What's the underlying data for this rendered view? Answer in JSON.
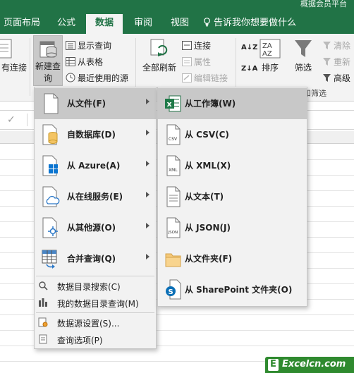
{
  "window": {
    "title_fragment": "概据会员平台"
  },
  "tabs": [
    {
      "label": "页面布局",
      "active": false
    },
    {
      "label": "公式",
      "active": false
    },
    {
      "label": "数据",
      "active": true
    },
    {
      "label": "审阅",
      "active": false
    },
    {
      "label": "视图",
      "active": false
    },
    {
      "label": "告诉我你想要做什么",
      "active": false
    }
  ],
  "ribbon": {
    "existing_connections": "有连接",
    "new_query": {
      "line1": "新建查",
      "line2": "询"
    },
    "show_queries": "显示查询",
    "from_table": "从表格",
    "recent_sources": "最近使用的源",
    "refresh_all": "全部刷新",
    "connections": "连接",
    "properties": "属性",
    "edit_links": "编辑链接",
    "sort_az": "A↓Z",
    "sort_za": "Z↓A",
    "sort": "排序",
    "filter": "筛选",
    "clear": "清除",
    "reapply": "重新",
    "advanced": "高级",
    "sort_filter_group": "和筛选"
  },
  "main_menu": {
    "items": [
      {
        "label": "从文件(F)",
        "icon": "file-icon",
        "submenu": true,
        "selected": true
      },
      {
        "label": "自数据库(D)",
        "icon": "database-icon",
        "submenu": true,
        "selected": false
      },
      {
        "label": "从 Azure(A)",
        "icon": "azure-icon",
        "submenu": true,
        "selected": false
      },
      {
        "label": "从在线服务(E)",
        "icon": "cloud-icon",
        "submenu": true,
        "selected": false
      },
      {
        "label": "从其他源(O)",
        "icon": "other-source-icon",
        "submenu": true,
        "selected": false
      },
      {
        "label": "合并查询(Q)",
        "icon": "merge-table-icon",
        "submenu": true,
        "selected": false
      }
    ],
    "small_items": [
      {
        "label": "数据目录搜索(C)",
        "icon": "catalog-search-icon"
      },
      {
        "label": "我的数据目录查询(M)",
        "icon": "catalog-queries-icon"
      },
      {
        "label": "数据源设置(S)...",
        "icon": "source-settings-icon"
      },
      {
        "label": "查询选项(P)",
        "icon": "query-options-icon"
      }
    ]
  },
  "sub_menu": {
    "items": [
      {
        "label": "从工作簿(W)",
        "icon": "excel-workbook-icon",
        "selected": true
      },
      {
        "label": "从 CSV(C)",
        "icon": "csv-file-icon",
        "selected": false
      },
      {
        "label": "从 XML(X)",
        "icon": "xml-file-icon",
        "selected": false
      },
      {
        "label": "从文本(T)",
        "icon": "text-file-icon",
        "selected": false
      },
      {
        "label": "从 JSON(J)",
        "icon": "json-file-icon",
        "selected": false
      },
      {
        "label": "从文件夹(F)",
        "icon": "folder-icon",
        "selected": false
      },
      {
        "label": "从 SharePoint 文件夹(O)",
        "icon": "sharepoint-icon",
        "selected": false
      }
    ],
    "icon_text": {
      "csv": "CSV",
      "xml": "XML",
      "json": "JSON"
    }
  },
  "watermark": {
    "text": "Excelcn.com"
  },
  "colors": {
    "accent": "#217346",
    "menu_bg": "#f2f2f2",
    "selected": "#c8c8c8"
  }
}
